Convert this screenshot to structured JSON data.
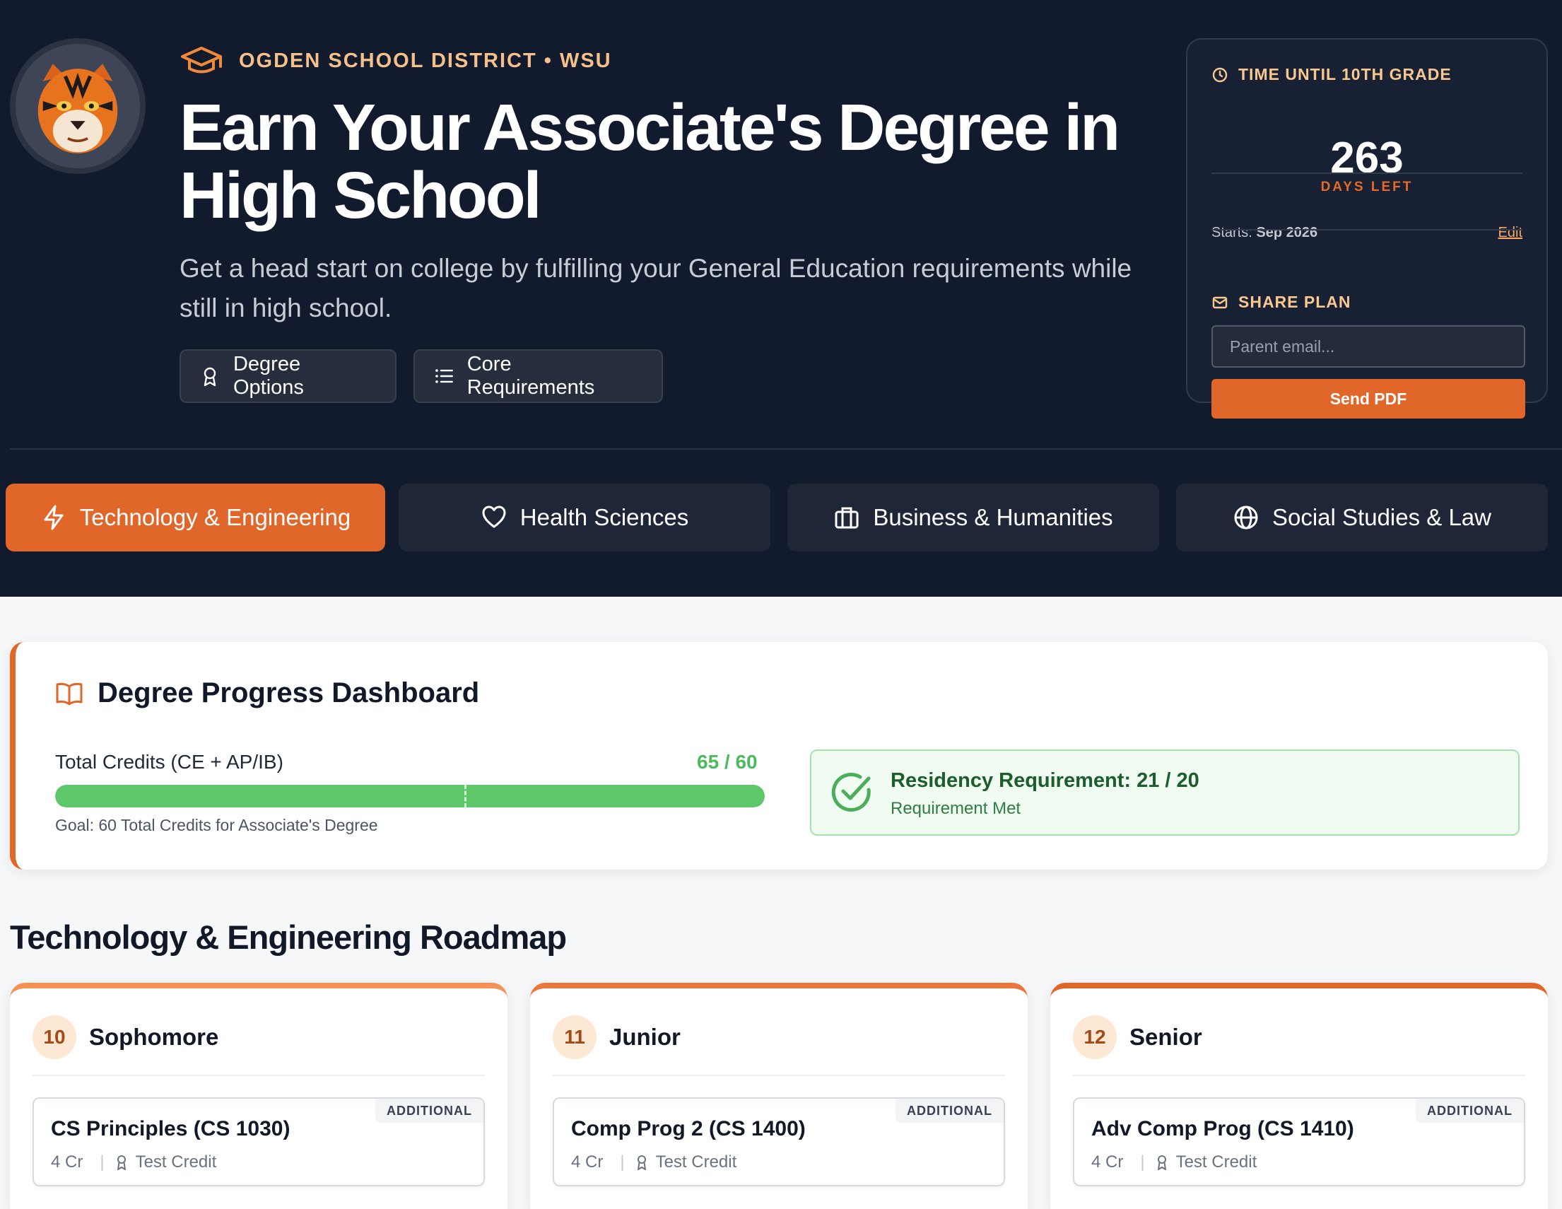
{
  "hero": {
    "district": "OGDEN SCHOOL DISTRICT • WSU",
    "title": "Earn Your Associate's Degree in High School",
    "subtitle": "Get a head start on college by fulfilling your General Education requirements while still in high school.",
    "buttons": {
      "degree_options": "Degree Options",
      "core_requirements": "Core Requirements"
    }
  },
  "countdown": {
    "heading": "TIME UNTIL 10TH GRADE",
    "days": "263",
    "days_label": "DAYS LEFT",
    "starts_label": "Starts:",
    "starts_value": "Sep 2026",
    "edit_label": "Edit"
  },
  "share": {
    "heading": "SHARE PLAN",
    "email_placeholder": "Parent email...",
    "send_label": "Send PDF"
  },
  "tabs": [
    {
      "label": "Technology & Engineering",
      "icon": "lightning-icon",
      "active": true
    },
    {
      "label": "Health Sciences",
      "icon": "heart-icon",
      "active": false
    },
    {
      "label": "Business & Humanities",
      "icon": "briefcase-icon",
      "active": false
    },
    {
      "label": "Social Studies & Law",
      "icon": "globe-icon",
      "active": false
    }
  ],
  "dashboard": {
    "title": "Degree Progress Dashboard",
    "credits_label": "Total Credits (CE + AP/IB)",
    "credits_value": "65 / 60",
    "credits_earned": 65,
    "credits_goal": 60,
    "goal_text": "Goal: 60 Total Credits for Associate's Degree",
    "residency_title": "Residency Requirement: 21 / 20",
    "residency_status": "Requirement Met"
  },
  "roadmap": {
    "title": "Technology & Engineering Roadmap",
    "years": [
      {
        "grade": "10",
        "name": "Sophomore",
        "course": {
          "tag": "ADDITIONAL",
          "name": "CS Principles (CS 1030)",
          "credits": "4 Cr",
          "type": "Test Credit"
        }
      },
      {
        "grade": "11",
        "name": "Junior",
        "course": {
          "tag": "ADDITIONAL",
          "name": "Comp Prog 2 (CS 1400)",
          "credits": "4 Cr",
          "type": "Test Credit"
        }
      },
      {
        "grade": "12",
        "name": "Senior",
        "course": {
          "tag": "ADDITIONAL",
          "name": "Adv Comp Prog (CS 1410)",
          "credits": "4 Cr",
          "type": "Test Credit"
        }
      }
    ]
  },
  "colors": {
    "accent": "#e0662a",
    "hero_bg": "#121a2d",
    "success": "#5dc76a"
  }
}
